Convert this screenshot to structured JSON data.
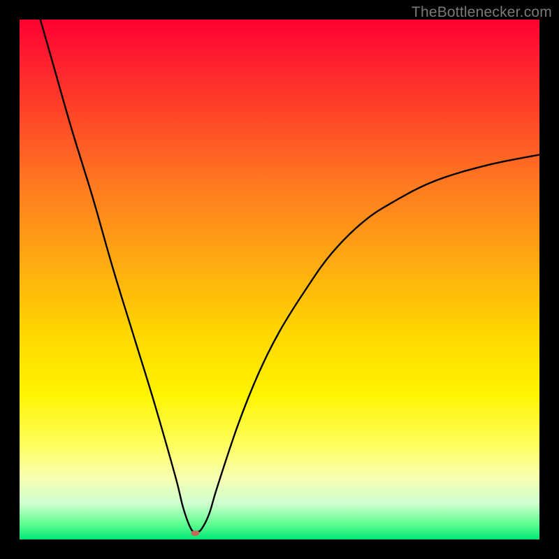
{
  "watermark": "TheBottlenecker.com",
  "chart_data": {
    "type": "line",
    "title": "",
    "xlabel": "",
    "ylabel": "",
    "xlim": [
      0,
      100
    ],
    "ylim": [
      0,
      100
    ],
    "grid": false,
    "legend": false,
    "marker": {
      "x": 33.8,
      "y": 1.2,
      "color": "#c46a5a",
      "rx": 6,
      "ry": 4
    },
    "background_gradient": {
      "top": "#ff0030",
      "middle": "#ffd600",
      "bottom": "#00e878"
    },
    "series": [
      {
        "name": "bottleneck-curve",
        "color": "#000000",
        "x": [
          4.0,
          6,
          10,
          14,
          18,
          22,
          26,
          30,
          31.5,
          33.0,
          34.0,
          35.0,
          36.5,
          38,
          42,
          46,
          50,
          55,
          60,
          66,
          72,
          80,
          90,
          100
        ],
        "y": [
          100,
          93,
          79,
          66,
          52,
          39,
          26,
          12,
          6.0,
          2.0,
          1.5,
          2.0,
          5.0,
          10,
          22,
          32,
          40,
          48,
          55,
          61,
          65,
          69,
          72,
          74
        ]
      }
    ]
  }
}
